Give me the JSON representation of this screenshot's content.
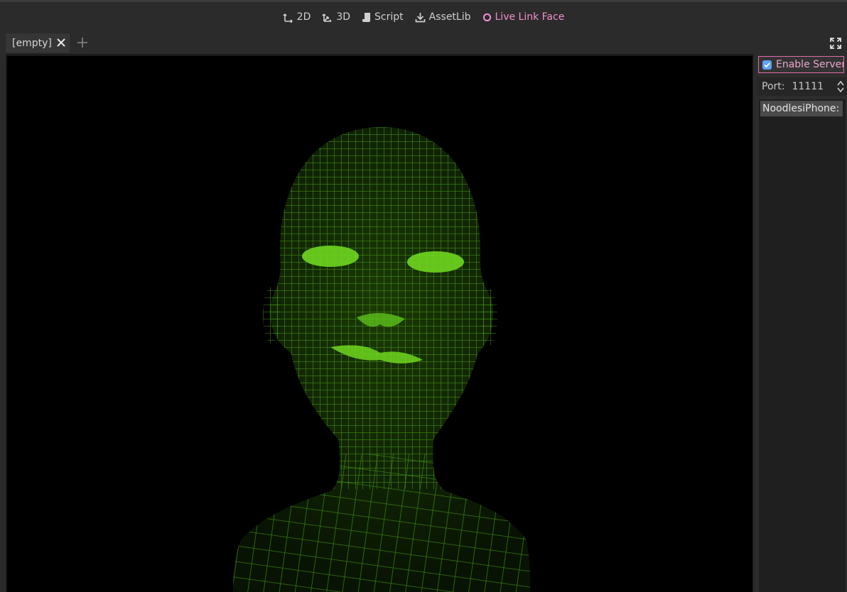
{
  "main_buttons": [
    {
      "label": "2D",
      "icon": "2d-icon"
    },
    {
      "label": "3D",
      "icon": "3d-icon"
    },
    {
      "label": "Script",
      "icon": "script-icon"
    },
    {
      "label": "AssetLib",
      "icon": "download-icon"
    },
    {
      "label": "Live Link Face",
      "icon": "circle-icon",
      "active": true
    }
  ],
  "tabs": [
    {
      "label": "[empty]"
    }
  ],
  "dock": {
    "enable_server_label": "Enable Server",
    "enable_server_checked": true,
    "port_label": "Port:",
    "port_value": "11111",
    "devices": [
      "NoodlesiPhone: E"
    ]
  },
  "colors": {
    "accent_pink": "#e06aa8",
    "checkbox_blue": "#5ea3f5",
    "wire_green": "#4fa818",
    "glow_green": "#6fd61f"
  }
}
